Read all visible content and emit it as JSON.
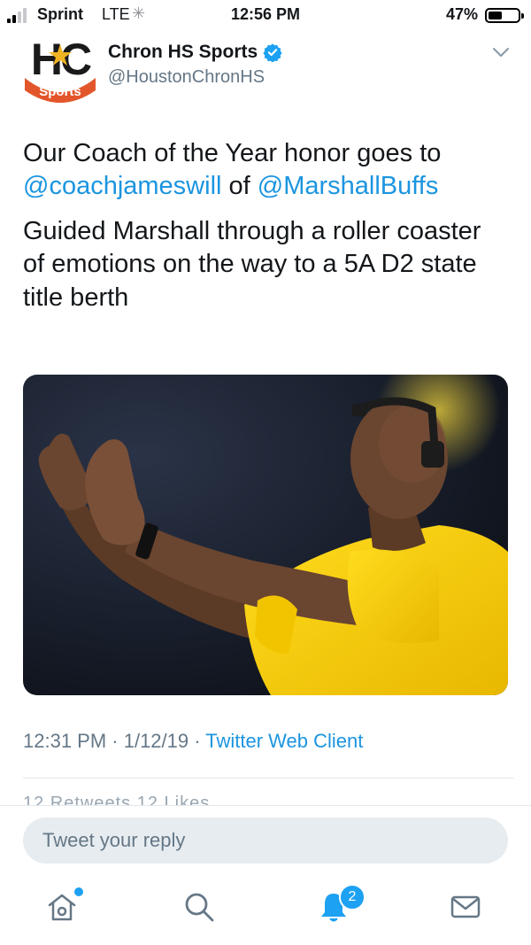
{
  "status_bar": {
    "carrier": "Sprint",
    "network": "LTE",
    "time": "12:56 PM",
    "battery_percent": "47%",
    "battery_level": 0.47
  },
  "tweet": {
    "author_name": "Chron HS Sports",
    "author_handle": "@HoustonChronHS",
    "logo_text_top": "HC",
    "logo_text_bottom": "Sports",
    "text_line1_before": "Our Coach of the Year honor goes to ",
    "mention1": "@coachjameswill",
    "text_line1_middle": " of ",
    "mention2": "@MarshallBuffs",
    "text_paragraph2": "Guided Marshall through a roller coaster of emotions on the way to a 5A D2 state title berth",
    "photo_description_icon": "coach-photo",
    "timestamp": "12:31 PM · 1/12/19 · ",
    "source": "Twitter Web Client",
    "engagement_partial": "12 Retweets 12 Likes"
  },
  "reply": {
    "placeholder": "Tweet your reply"
  },
  "tabbar": {
    "items": [
      {
        "name": "home-icon"
      },
      {
        "name": "search-icon"
      },
      {
        "name": "notifications-icon"
      },
      {
        "name": "messages-icon"
      }
    ],
    "notification_count": "2"
  },
  "colors": {
    "link": "#1b95e0",
    "accent": "#1da1f2",
    "secondary_text": "#657786"
  }
}
